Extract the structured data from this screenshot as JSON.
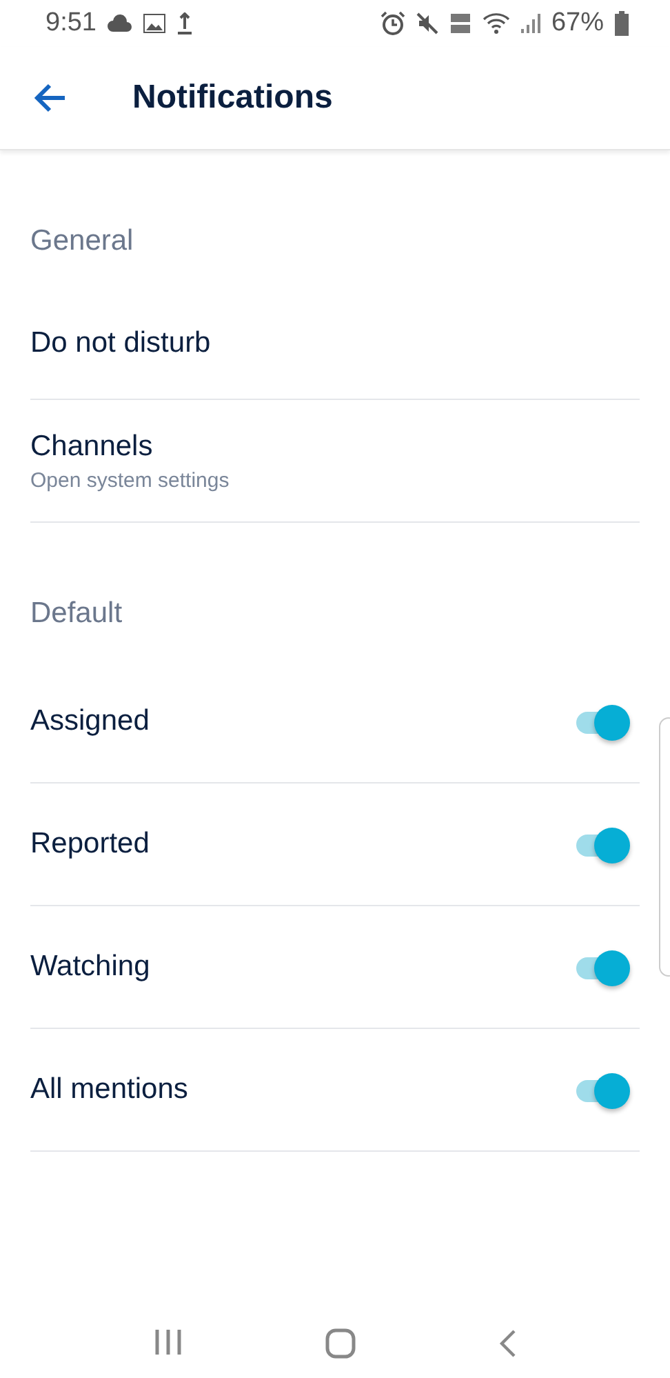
{
  "status_bar": {
    "time": "9:51",
    "battery": "67%"
  },
  "header": {
    "title": "Notifications"
  },
  "sections": [
    {
      "title": "General",
      "items": [
        {
          "kind": "link",
          "label": "Do not disturb"
        },
        {
          "kind": "link",
          "label": "Channels",
          "subtitle": "Open system settings"
        }
      ]
    },
    {
      "title": "Default",
      "items": [
        {
          "kind": "toggle",
          "label": "Assigned",
          "on": true
        },
        {
          "kind": "toggle",
          "label": "Reported",
          "on": true
        },
        {
          "kind": "toggle",
          "label": "Watching",
          "on": true
        },
        {
          "kind": "toggle",
          "label": "All mentions",
          "on": true
        }
      ]
    }
  ]
}
